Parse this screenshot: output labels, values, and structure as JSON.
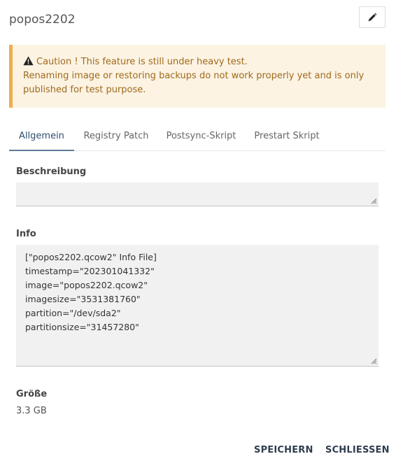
{
  "header": {
    "title": "popos2202",
    "edit_icon": "pencil-icon"
  },
  "alert": {
    "icon": "warning-triangle-icon",
    "line1": "Caution ! This feature is still under heavy test.",
    "line2": "Renaming image or restoring backups do not work properly yet and is only",
    "line3": "published for test purpose."
  },
  "tabs": [
    {
      "label": "Allgemein",
      "active": true
    },
    {
      "label": "Registry Patch",
      "active": false
    },
    {
      "label": "Postsync-Skript",
      "active": false
    },
    {
      "label": "Prestart Skript",
      "active": false
    }
  ],
  "description": {
    "label": "Beschreibung",
    "value": ""
  },
  "info": {
    "label": "Info",
    "lines": [
      "[\"popos2202.qcow2\" Info File]",
      "timestamp=\"202301041332\"",
      "image=\"popos2202.qcow2\"",
      "imagesize=\"3531381760\"",
      "partition=\"/dev/sda2\"",
      "partitionsize=\"31457280\""
    ]
  },
  "size": {
    "label": "Größe",
    "value": "3.3 GB"
  },
  "actions": {
    "save_label": "SPEICHERN",
    "close_label": "SCHLIESSEN"
  },
  "colors": {
    "alert_background": "#fcf3e3",
    "alert_border": "#f0ad4e",
    "alert_text": "#a06a1c",
    "active_tab_underline": "#5b7c99"
  }
}
